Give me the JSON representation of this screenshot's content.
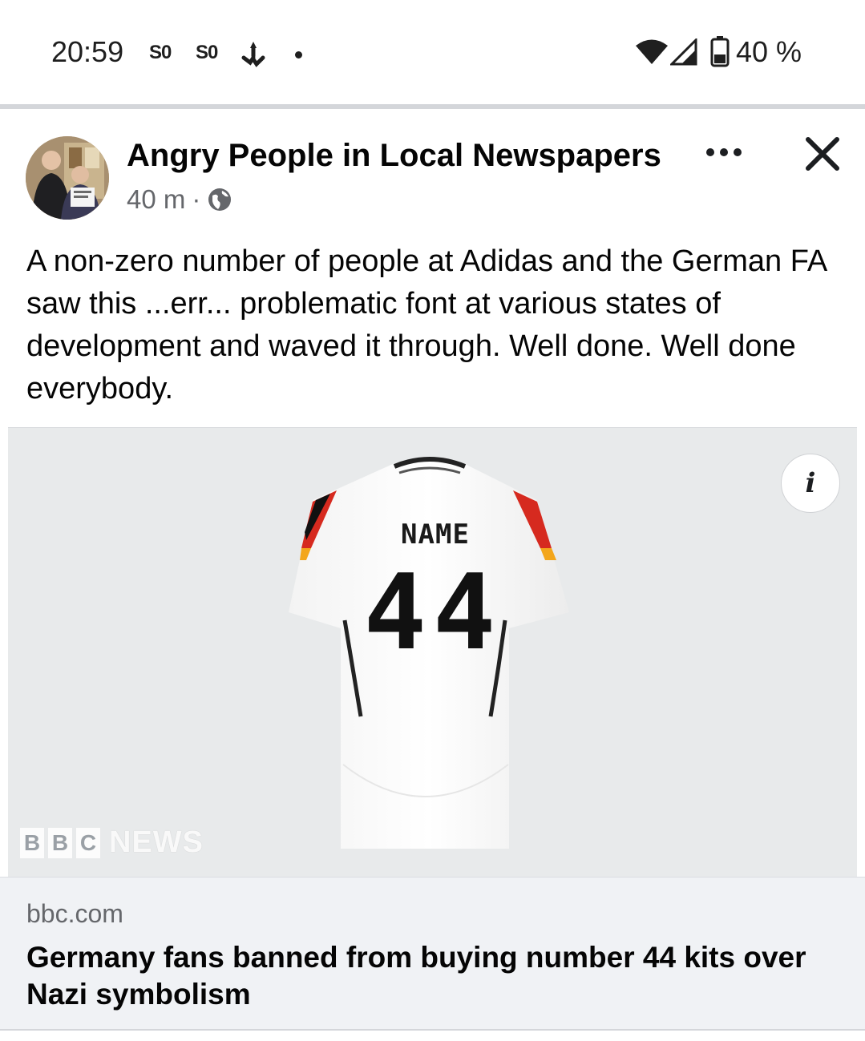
{
  "status_bar": {
    "time": "20:59",
    "notif1": "S0",
    "notif2": "S0",
    "battery_text": "40 %"
  },
  "post": {
    "page_name": "Angry People in Local Newspapers",
    "time_ago": "40 m",
    "separator": "·",
    "audience_icon": "globe-icon",
    "text": "A non-zero number of people at Adidas and the German FA saw this ...err... problematic font at various states of development and waved it through. Well done. Well done everybody."
  },
  "link_preview": {
    "jersey_name": "NAME",
    "jersey_number": "44",
    "watermark_blocks": [
      "B",
      "B",
      "C"
    ],
    "watermark_text": "NEWS",
    "info_label": "i",
    "domain": "bbc.com",
    "title": "Germany fans banned from buying number 44 kits over Nazi symbolism"
  },
  "colors": {
    "secondary_text": "#65676b",
    "footer_bg": "#f0f2f5",
    "image_bg": "#e8eaeb"
  }
}
